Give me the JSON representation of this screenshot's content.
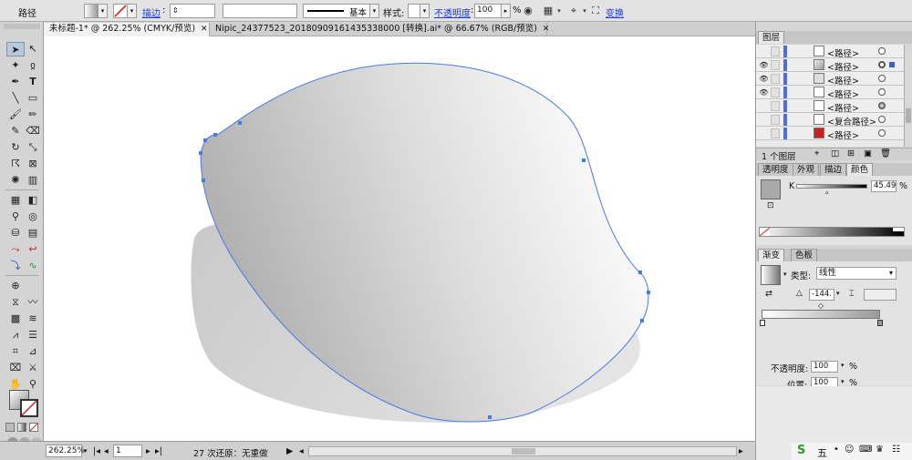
{
  "control_bar": {
    "object_type": "路径",
    "stroke_label": "描边",
    "stroke_profile": "基本",
    "style_label": "样式:",
    "opacity_label": "不透明度",
    "opacity_value": "100",
    "opacity_unit": "%",
    "transform_label": "变换"
  },
  "tabs": [
    {
      "label": "未标题-1* @ 262.25% (CMYK/预览)",
      "active": true
    },
    {
      "label": "Nipic_24377523_20180909161435338000 [转换].ai* @ 66.67% (RGB/预览)",
      "active": false
    }
  ],
  "tools": [
    "selection",
    "direct-selection",
    "magic-wand",
    "lasso",
    "pen",
    "type",
    "line",
    "rectangle",
    "paintbrush",
    "pencil",
    "blob-brush",
    "eraser",
    "rotate",
    "scale",
    "warp",
    "free-transform",
    "symbol-sprayer",
    "column-graph",
    "mesh",
    "gradient",
    "eyedropper",
    "blend",
    "live-paint",
    "live-paint-selection",
    "artboard",
    "slice",
    "hand",
    "zoom"
  ],
  "layers_panel": {
    "title": "图层",
    "rows": [
      {
        "name": "<路径>",
        "visible": false,
        "selected": false
      },
      {
        "name": "<路径>",
        "visible": true,
        "selected": true
      },
      {
        "name": "<路径>",
        "visible": true,
        "selected": false
      },
      {
        "name": "<路径>",
        "visible": true,
        "selected": false
      },
      {
        "name": "<路径>",
        "visible": false,
        "selected": false
      },
      {
        "name": "<复合路径>",
        "visible": false,
        "selected": false
      },
      {
        "name": "<路径>",
        "visible": false,
        "selected": false
      }
    ],
    "footer": "1 个图层"
  },
  "color_panel": {
    "tabs": [
      "透明度",
      "外观",
      "描边",
      "颜色"
    ],
    "channel_label": "K",
    "channel_value": "45.49",
    "channel_unit": "%"
  },
  "gradient_panel": {
    "tabs": [
      "渐变",
      "色板"
    ],
    "type_label": "类型:",
    "type_value": "线性",
    "angle_value": "-144.",
    "opacity_label": "不透明度:",
    "opacity_value": "100",
    "location_label": "位置:",
    "location_value": "100",
    "unit": "%"
  },
  "status_bar": {
    "zoom": "262.25%",
    "artboard": "1",
    "status": "27 次还原：无重做"
  },
  "colors": {
    "path_stroke": "#4a7ae0",
    "shape_light": "#f5f5f5",
    "shape_dark": "#b4b4b4",
    "shadow": "#cfcfcf"
  }
}
